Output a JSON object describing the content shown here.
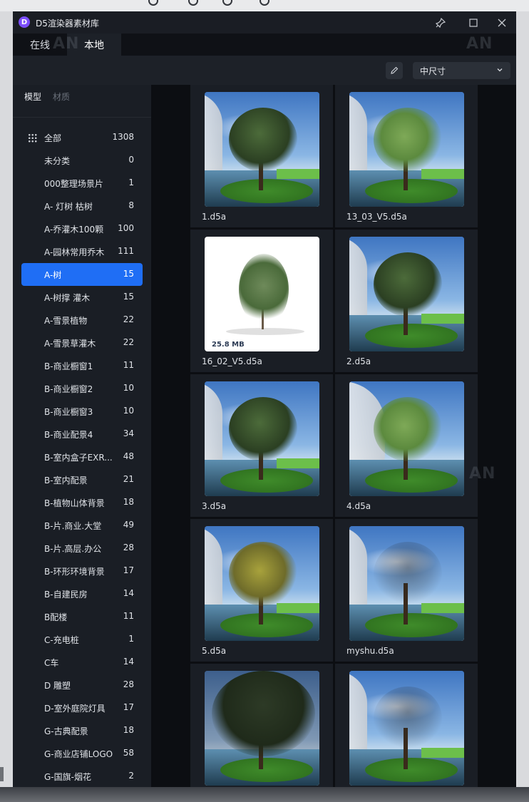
{
  "window": {
    "title": "D5渲染器素材库",
    "logo_letter": "D"
  },
  "tabs": [
    {
      "label": "在线"
    },
    {
      "label": "本地"
    }
  ],
  "watermark": "AN",
  "toolbar": {
    "size_select": "中尺寸"
  },
  "sidebar": {
    "subtabs": [
      "模型",
      "材质"
    ],
    "categories": [
      {
        "label": "全部",
        "count": "1308"
      },
      {
        "label": "未分类",
        "count": "0"
      },
      {
        "label": "000整理场景片",
        "count": "1"
      },
      {
        "label": "A- 灯树 枯树",
        "count": "8"
      },
      {
        "label": "A-乔灌木100颗",
        "count": "100"
      },
      {
        "label": "A-园林常用乔木",
        "count": "111"
      },
      {
        "label": "A-树",
        "count": "15"
      },
      {
        "label": "A-树撑 灌木",
        "count": "15"
      },
      {
        "label": "A-雪景植物",
        "count": "22"
      },
      {
        "label": "A-雪景草灌木",
        "count": "22"
      },
      {
        "label": "B-商业橱窗1",
        "count": "11"
      },
      {
        "label": "B-商业橱窗2",
        "count": "10"
      },
      {
        "label": "B-商业橱窗3",
        "count": "10"
      },
      {
        "label": "B-商业配景4",
        "count": "34"
      },
      {
        "label": "B-室内盒子EXR...",
        "count": "48"
      },
      {
        "label": "B-室内配景",
        "count": "21"
      },
      {
        "label": "B-植物山体背景",
        "count": "18"
      },
      {
        "label": "B-片.商业.大堂",
        "count": "49"
      },
      {
        "label": "B-片.高层.办公",
        "count": "28"
      },
      {
        "label": "B-环形环境背景",
        "count": "17"
      },
      {
        "label": "B-自建民房",
        "count": "14"
      },
      {
        "label": "B配楼",
        "count": "11"
      },
      {
        "label": "C-充电桩",
        "count": "1"
      },
      {
        "label": "C车",
        "count": "14"
      },
      {
        "label": "D 雕塑",
        "count": "28"
      },
      {
        "label": "D-室外庭院灯具",
        "count": "17"
      },
      {
        "label": "G-古典配景",
        "count": "18"
      },
      {
        "label": "G-商业店铺LOGO",
        "count": "58"
      },
      {
        "label": "G-国旗-烟花",
        "count": "2"
      }
    ]
  },
  "assets": [
    {
      "name": "1.d5a"
    },
    {
      "name": "13_03_V5.d5a"
    },
    {
      "name": "16_02_V5.d5a",
      "size": "25.8 MB"
    },
    {
      "name": "2.d5a"
    },
    {
      "name": "3.d5a"
    },
    {
      "name": "4.d5a"
    },
    {
      "name": "5.d5a"
    },
    {
      "name": "myshu.d5a"
    },
    {
      "name": ""
    },
    {
      "name": ""
    }
  ]
}
